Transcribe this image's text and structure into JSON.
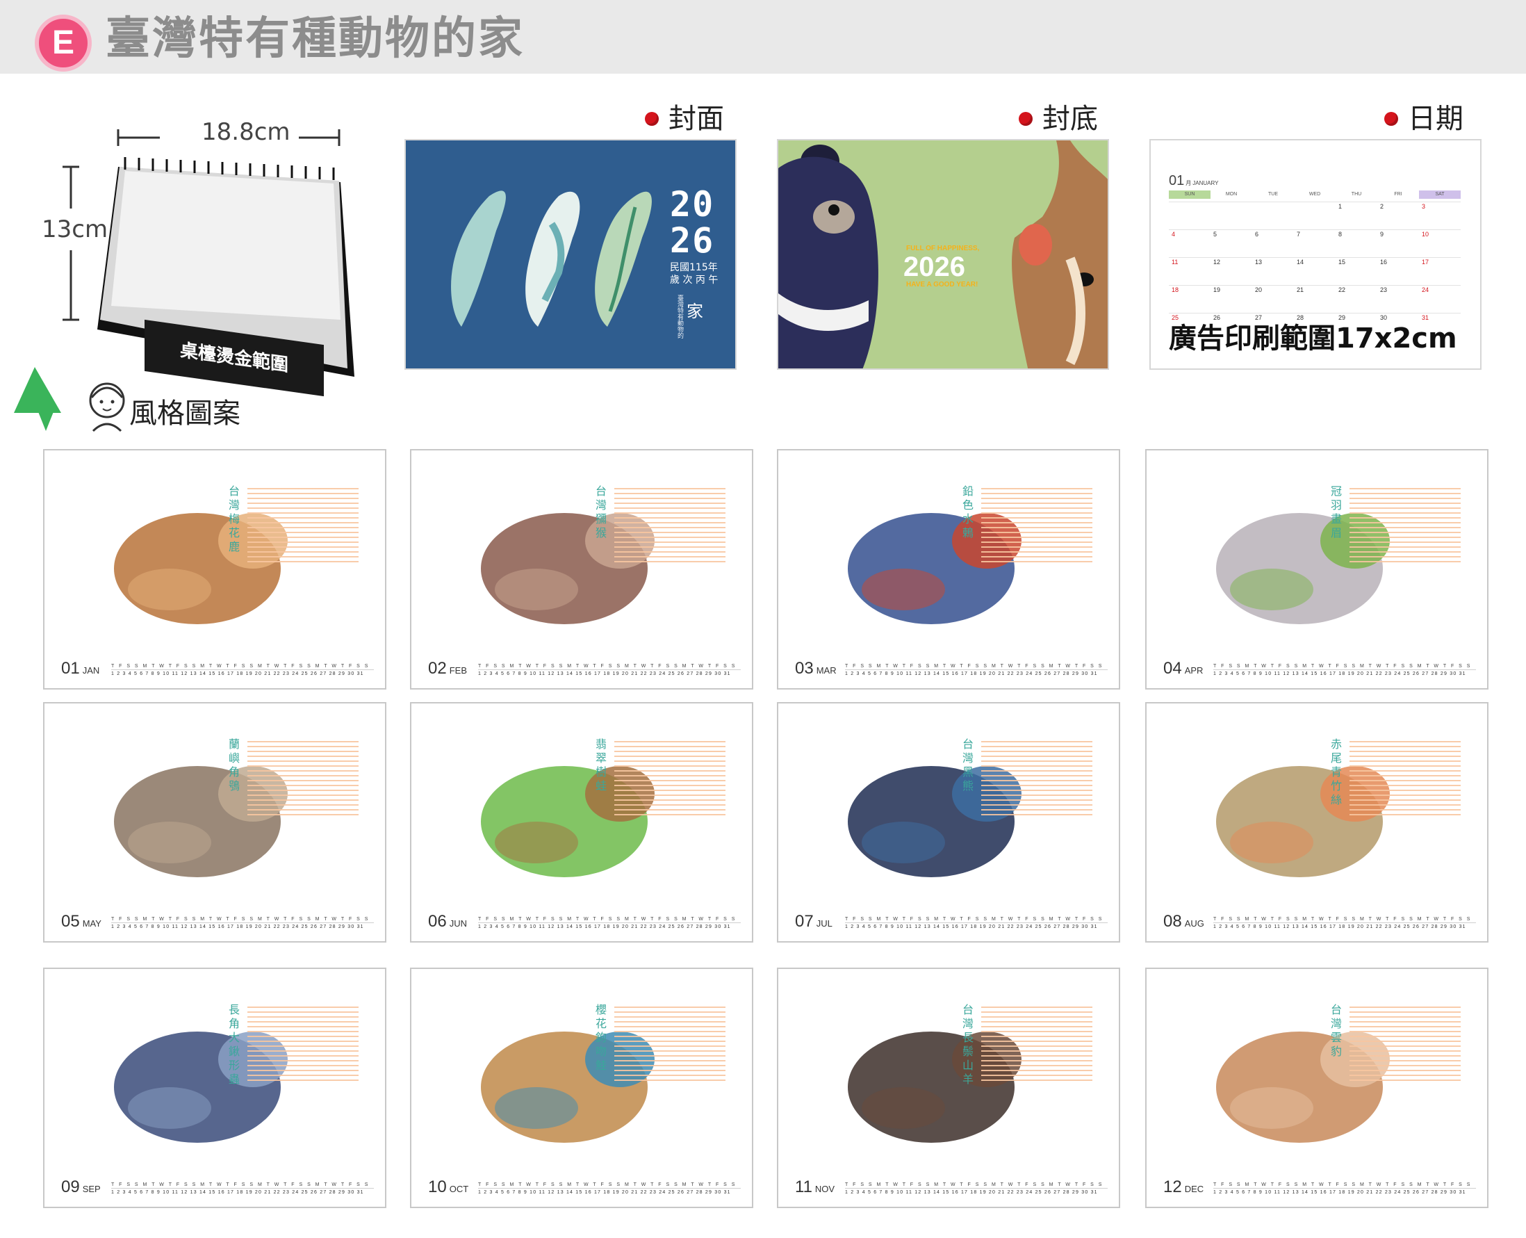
{
  "banner": {
    "badge": "E",
    "title": "臺灣特有種動物的家"
  },
  "desk": {
    "width_label": "18.8cm",
    "height_label": "13cm",
    "stamp_label": "桌檯燙金範圍"
  },
  "style_label": "風格圖案",
  "labels": {
    "cover": "封面",
    "back": "封底",
    "date": "日期"
  },
  "cover": {
    "year_top": "20",
    "year_bottom": "26",
    "roc_year": "民國115年",
    "ganzhi": "歲 次 丙 午",
    "vertical_text": "臺灣特有動物的",
    "home_char": "家"
  },
  "back": {
    "line1": "FULL OF HAPPINESS,",
    "year": "2026",
    "line2": "HAVE A GOOD YEAR!"
  },
  "date_sample": {
    "month_num": "01",
    "month_cn": "月",
    "month_en": "JANUARY",
    "weekdays": [
      "SUN",
      "MON",
      "TUE",
      "WED",
      "THU",
      "FRI",
      "SAT"
    ],
    "cells": [
      "",
      "",
      "",
      "",
      "1",
      "2",
      "3",
      "4",
      "5",
      "6",
      "7",
      "8",
      "9",
      "10",
      "11",
      "12",
      "13",
      "14",
      "15",
      "16",
      "17",
      "18",
      "19",
      "20",
      "21",
      "22",
      "23",
      "24",
      "25",
      "26",
      "27",
      "28",
      "29",
      "30",
      "31"
    ],
    "ad_text": "廣告印刷範圍17x2cm",
    "colors": {
      "holiday": "#d4141c",
      "sun_header": "#b7d99a",
      "sat_header": "#cfc0ea"
    }
  },
  "months": [
    {
      "num": "01",
      "en": "JAN",
      "name": "台灣梅花鹿"
    },
    {
      "num": "02",
      "en": "FEB",
      "name": "台灣獼猴"
    },
    {
      "num": "03",
      "en": "MAR",
      "name": "鉛色水鶇"
    },
    {
      "num": "04",
      "en": "APR",
      "name": "冠羽畫眉"
    },
    {
      "num": "05",
      "en": "MAY",
      "name": "蘭嶼角鴞"
    },
    {
      "num": "06",
      "en": "JUN",
      "name": "翡翠樹蛙"
    },
    {
      "num": "07",
      "en": "JUL",
      "name": "台灣黑熊"
    },
    {
      "num": "08",
      "en": "AUG",
      "name": "赤尾青竹絲"
    },
    {
      "num": "09",
      "en": "SEP",
      "name": "長角大鍬形蟲"
    },
    {
      "num": "10",
      "en": "OCT",
      "name": "櫻花鉤吻鮭"
    },
    {
      "num": "11",
      "en": "NOV",
      "name": "台灣長鬃山羊"
    },
    {
      "num": "12",
      "en": "DEC",
      "name": "台灣雲豹"
    }
  ],
  "strip": {
    "weekday_row": "T F S S M T W T F S S M T W T F S S M T W T F S S M T W T F S S",
    "day_row": "1 2 3 4 5 6 7 8 9 10 11 12 13 14 15 16 17 18 19 20 21 22 23 24 25 26 27 28 29 30 31"
  }
}
